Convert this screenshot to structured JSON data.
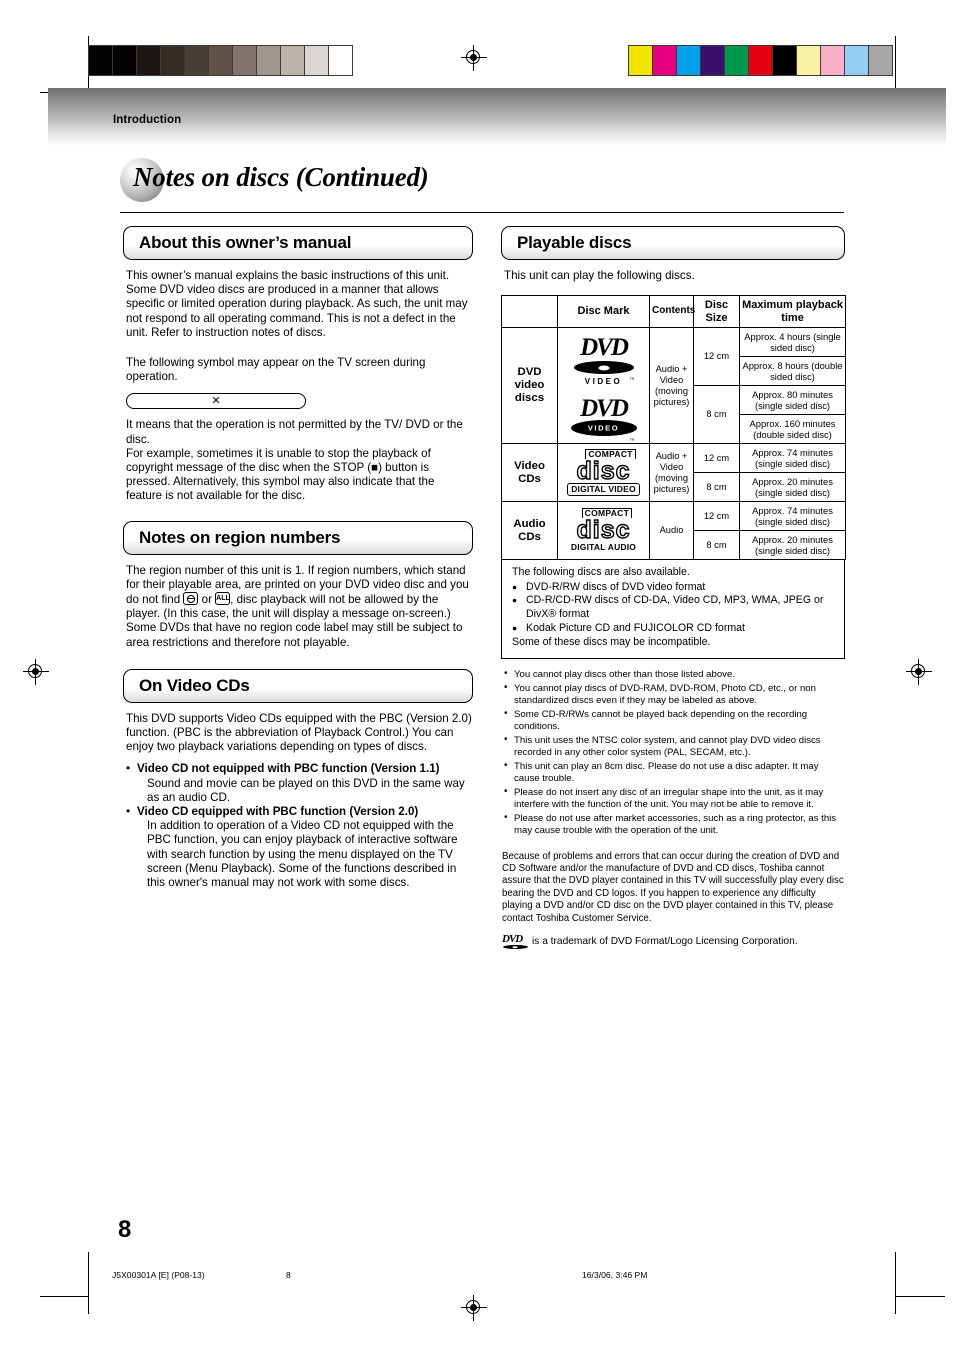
{
  "section_label": "Introduction",
  "page_title": "Notes on discs (Continued)",
  "page_number": "8",
  "left_column": {
    "owner_manual": {
      "heading": "About this owner’s manual",
      "para1": "This owner’s manual explains the basic instructions of this unit. Some DVD video discs are produced in a manner that allows specific or limited operation during playback. As such, the unit may not respond to all operating command. This is not a defect in the unit. Refer to instruction notes of discs.",
      "para2": "The following symbol may appear on the TV screen during operation.",
      "prohibit_symbol": "✕",
      "para3_line1": "It means that the operation is not permitted by the TV/ DVD or the disc.",
      "para3_line2": "For example, sometimes it is unable to stop the playback of copyright message of the disc when the STOP (■) button is pressed. Alternatively, this symbol may also indicate that the feature is not available for the disc."
    },
    "region_numbers": {
      "heading": "Notes on region numbers",
      "text_a": "The region number of this unit is 1. If region numbers, which stand for their playable area, are printed on your DVD video disc and you do not find",
      "text_or": "or",
      "text_b": ", disc playback will not be allowed by the player. (In this case, the unit will display a message on-screen.)",
      "text_c": "Some DVDs that have no region code label may still be subject to area restrictions and therefore not playable.",
      "icon_globe_label": "1",
      "icon_all_label": "ALL"
    },
    "video_cds": {
      "heading": "On Video CDs",
      "intro": "This DVD supports Video CDs equipped with the PBC (Version 2.0) function. (PBC is the abbreviation of Playback Control.) You can enjoy two playback variations depending on types of discs.",
      "items": [
        {
          "title": "Video CD not equipped with PBC function (Version 1.1)",
          "body": "Sound and movie can be played on this DVD in the same way as an audio CD."
        },
        {
          "title": "Video CD equipped with PBC function (Version 2.0)",
          "body": "In addition to operation of a Video CD not equipped with the PBC function, you can enjoy playback of interactive software with search function by using the menu displayed on the TV screen (Menu Playback). Some of the functions described in this owner's manual may not work with some discs."
        }
      ]
    }
  },
  "right_column": {
    "playable_discs": {
      "heading": "Playable discs",
      "intro": "This unit can play the following discs.",
      "table": {
        "headers": [
          "",
          "Disc Mark",
          "Contents",
          "Disc Size",
          "Maximum playback time"
        ],
        "rows": [
          {
            "category": "DVD video discs",
            "mark_primary": "DVD",
            "mark_primary_sub": "VIDEO",
            "mark_secondary": "DVD",
            "mark_secondary_sub": "VIDEO",
            "contents": "Audio + Video (moving pictures)",
            "sizes": [
              {
                "size": "12 cm",
                "times": [
                  "Approx. 4 hours (single sided disc)",
                  "Approx. 8 hours (double sided disc)"
                ]
              },
              {
                "size": "8 cm",
                "times": [
                  "Approx. 80 minutes (single sided disc)",
                  "Approx. 160 minutes (double sided disc)"
                ]
              }
            ]
          },
          {
            "category": "Video CDs",
            "mark_top": "COMPACT",
            "mark_word": "disc",
            "mark_bottom": "DIGITAL VIDEO",
            "contents": "Audio + Video (moving pictures)",
            "sizes": [
              {
                "size": "12 cm",
                "times": [
                  "Approx. 74 minutes (single sided disc)"
                ]
              },
              {
                "size": "8 cm",
                "times": [
                  "Approx. 20 minutes (single sided disc)"
                ]
              }
            ]
          },
          {
            "category": "Audio CDs",
            "mark_top": "COMPACT",
            "mark_word": "disc",
            "mark_bottom": "DIGITAL AUDIO",
            "contents": "Audio",
            "sizes": [
              {
                "size": "12 cm",
                "times": [
                  "Approx. 74 minutes (single sided disc)"
                ]
              },
              {
                "size": "8 cm",
                "times": [
                  "Approx. 20 minutes (single sided disc)"
                ]
              }
            ]
          }
        ]
      },
      "also_available": {
        "lead": "The following discs are also available.",
        "items": [
          "DVD-R/RW discs of DVD video format",
          "CD-R/CD-RW discs of CD-DA, Video CD, MP3, WMA, JPEG or DivX® format",
          "Kodak Picture CD and FUJICOLOR CD format"
        ],
        "tail": "Some of these discs may be incompatible."
      },
      "cautions": [
        "You cannot play discs other than those listed above.",
        "You cannot play discs of DVD-RAM, DVD-ROM, Photo CD, etc., or non standardized discs even if they may be labeled as above.",
        "Some CD-R/RWs cannot be played back depending on the recording conditions.",
        "This unit uses the NTSC color system, and cannot play DVD video discs recorded in any other color system (PAL, SECAM, etc.).",
        "This unit can play an 8cm disc. Please do not use a disc adapter. It may cause trouble.",
        "Please do not insert any disc of an irregular shape into the unit, as it may interfere with the function of the unit. You may not be able to remove it.",
        "Please do not use after market accessories, such as a ring protector, as this may cause trouble with the operation of the unit."
      ],
      "closing": "Because of problems and errors that can occur during the creation of DVD and CD Software and/or the manufacture of DVD and CD discs, Toshiba cannot assure that the DVD player contained in this TV will successfully play every disc bearing the DVD and CD logos.  If you happen to experience any difficulty playing a DVD and/or CD disc on the DVD player contained in this TV, please contact Toshiba Customer Service.",
      "trademark": "is a trademark of DVD Format/Logo Licensing Corporation."
    }
  },
  "footer": {
    "code": "J5X00301A [E] (P08-13)",
    "page": "8",
    "date": "16/3/06, 3:46 PM"
  },
  "color_bars": {
    "left": [
      "#020202",
      "#040201",
      "#1c1714",
      "#332b26",
      "#4a3f38",
      "#5f5249",
      "#80736b",
      "#a1968e",
      "#bbb2ab",
      "#dbd6d1",
      "#ffffff"
    ],
    "right": [
      "#f2e600",
      "#e4007f",
      "#00a0e9",
      "#3b0e70",
      "#00984a",
      "#e50012",
      "#000000",
      "#faf1a6",
      "#f8b0c8",
      "#93cdf0",
      "#a6a6a6"
    ]
  }
}
